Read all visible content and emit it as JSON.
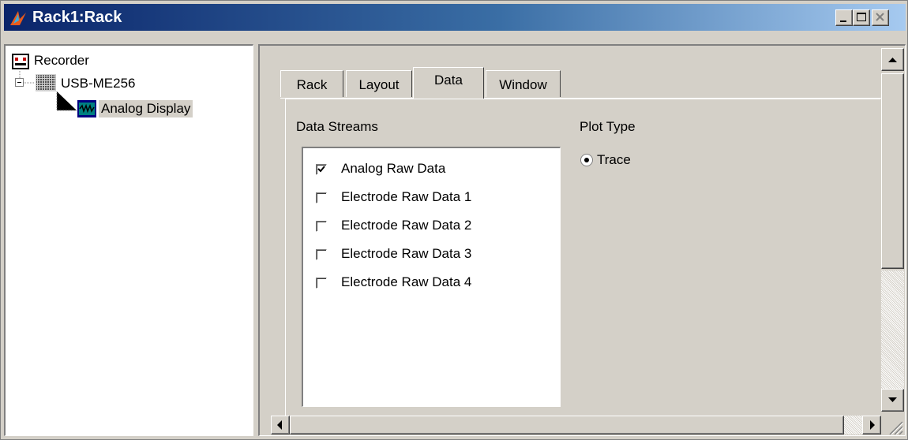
{
  "window": {
    "title": "Rack1:Rack",
    "colors": {
      "titlebar_start": "#0a246a",
      "titlebar_end": "#a6caf0",
      "face": "#d4d0c8"
    }
  },
  "tree": {
    "items": [
      {
        "label": "Recorder",
        "icon": "recorder-icon"
      },
      {
        "label": "USB-ME256",
        "icon": "device-grid-icon",
        "expander": "−"
      },
      {
        "label": "Analog Display",
        "icon": "analog-display-icon",
        "selected": true
      }
    ]
  },
  "tabs": [
    {
      "label": "Rack",
      "active": false
    },
    {
      "label": "Layout",
      "active": false
    },
    {
      "label": "Data",
      "active": true
    },
    {
      "label": "Window",
      "active": false
    }
  ],
  "data_panel": {
    "streams_label": "Data Streams",
    "streams": [
      {
        "label": "Analog Raw Data",
        "checked": true
      },
      {
        "label": "Electrode Raw Data 1",
        "checked": false
      },
      {
        "label": "Electrode Raw Data 2",
        "checked": false
      },
      {
        "label": "Electrode Raw Data 3",
        "checked": false
      },
      {
        "label": "Electrode Raw Data 4",
        "checked": false
      }
    ],
    "plot_type_label": "Plot Type",
    "plot_types": [
      {
        "label": "Trace",
        "selected": true
      }
    ]
  }
}
